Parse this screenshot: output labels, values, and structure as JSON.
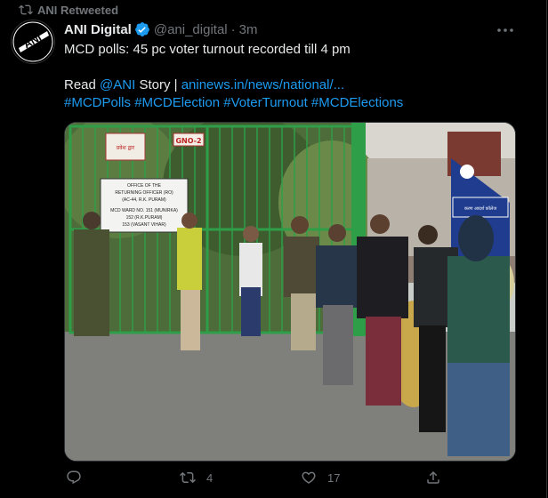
{
  "retweet_label": "ANI Retweeted",
  "author": {
    "name": "ANI Digital",
    "handle": "@ani_digital",
    "time": "3m",
    "avatar_text": "ANI"
  },
  "tweet": {
    "headline": "MCD polls: 45 pc voter turnout recorded till 4 pm",
    "read_prefix": "Read",
    "mention": "@ANI",
    "story_word": "Story |",
    "url": "aninews.in/news/national/...",
    "hashtags": [
      "#MCDPolls",
      "#MCDElection",
      "#VoterTurnout",
      "#MCDElections"
    ]
  },
  "media": {
    "sign_main": [
      "OFFICE OF THE",
      "RETURNING OFFICER (RO)",
      "(AC-44, R.K. PURAM)",
      "MCD WARD NO. 151 (MUNIRKA)",
      "152 (R.K.PURAM)",
      "153 (VASANT VIHAR)"
    ],
    "sign_gate": "GNO-2",
    "sign_hindi": "प्रवेश द्वार",
    "sign_blue": "करण आदर्श कॉलेज"
  },
  "actions": {
    "reply_count": "",
    "retweet_count": "4",
    "like_count": "17"
  },
  "colors": {
    "accent": "#1d9bf0",
    "muted": "#71767b",
    "text": "#e7e9ea",
    "background": "#000000"
  }
}
